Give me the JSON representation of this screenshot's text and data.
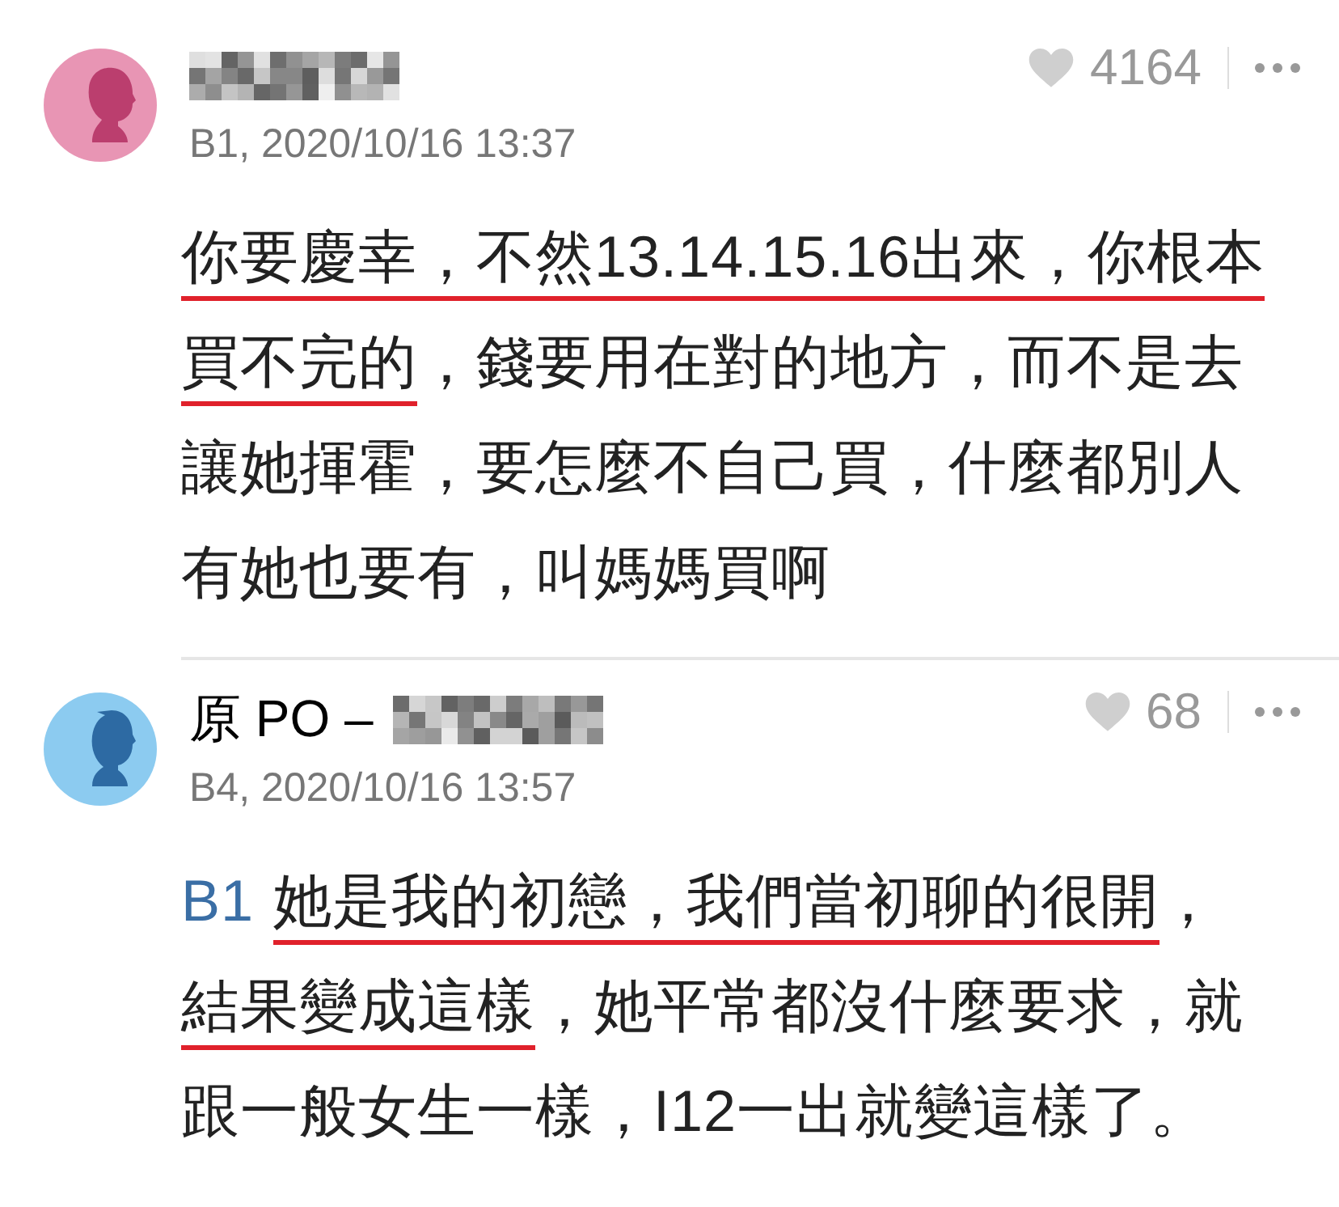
{
  "comments": [
    {
      "avatar": {
        "kind": "female"
      },
      "floor_time": "B1, 2020/10/16 13:37",
      "likes": "4164",
      "lines": [
        [
          {
            "kind": "text",
            "text": "你要慶幸，不然13.14.15.16出來，你根本",
            "underlined": true
          }
        ],
        [
          {
            "kind": "text",
            "text": "買不完的",
            "underlined": true
          },
          {
            "kind": "text",
            "text": "，錢要用在對的地方，而不是去",
            "underlined": false
          }
        ],
        [
          {
            "kind": "text",
            "text": "讓她揮霍，要怎麼不自己買，什麼都別人",
            "underlined": false
          }
        ],
        [
          {
            "kind": "text",
            "text": "有她也要有，叫媽媽買啊",
            "underlined": false
          }
        ]
      ]
    },
    {
      "avatar": {
        "kind": "male"
      },
      "author_label": "原 PO –",
      "floor_time": "B4, 2020/10/16 13:57",
      "likes": "68",
      "lines": [
        [
          {
            "kind": "mention",
            "text": "B1",
            "underlined": false
          },
          {
            "kind": "text",
            "text": "她是我的初戀，我們當初聊的很開",
            "underlined": true
          },
          {
            "kind": "text",
            "text": "，",
            "underlined": false
          }
        ],
        [
          {
            "kind": "text",
            "text": "結果變成這樣",
            "underlined": true
          },
          {
            "kind": "text",
            "text": "，她平常都沒什麼要求，就",
            "underlined": false
          }
        ],
        [
          {
            "kind": "text",
            "text": "跟一般女生一樣，I12一出就變這樣了。",
            "underlined": false
          }
        ]
      ]
    }
  ]
}
